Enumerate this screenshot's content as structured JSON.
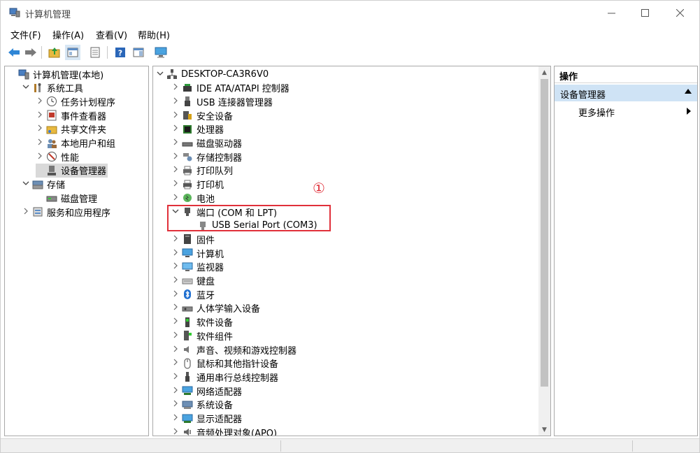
{
  "window": {
    "title": "计算机管理"
  },
  "menu": [
    "文件(F)",
    "操作(A)",
    "查看(V)",
    "帮助(H)"
  ],
  "left_tree": [
    {
      "label": "计算机管理(本地)",
      "level": 0,
      "arrow": "",
      "icon": "computer-management-icon"
    },
    {
      "label": "系统工具",
      "level": 1,
      "arrow": "v",
      "icon": "system-tools-icon"
    },
    {
      "label": "任务计划程序",
      "level": 2,
      "arrow": ">",
      "icon": "clock-icon"
    },
    {
      "label": "事件查看器",
      "level": 2,
      "arrow": ">",
      "icon": "event-viewer-icon"
    },
    {
      "label": "共享文件夹",
      "level": 2,
      "arrow": ">",
      "icon": "shared-folder-icon"
    },
    {
      "label": "本地用户和组",
      "level": 2,
      "arrow": ">",
      "icon": "users-icon"
    },
    {
      "label": "性能",
      "level": 2,
      "arrow": ">",
      "icon": "performance-icon"
    },
    {
      "label": "设备管理器",
      "level": 2,
      "arrow": "",
      "icon": "device-manager-icon",
      "selected": true
    },
    {
      "label": "存储",
      "level": 1,
      "arrow": "v",
      "icon": "storage-icon"
    },
    {
      "label": "磁盘管理",
      "level": 2,
      "arrow": "",
      "icon": "disk-management-icon"
    },
    {
      "label": "服务和应用程序",
      "level": 1,
      "arrow": ">",
      "icon": "services-icon"
    }
  ],
  "device_tree": [
    {
      "label": "DESKTOP-CA3R6V0",
      "level": 0,
      "arrow": "v",
      "icon": "computer-node-icon"
    },
    {
      "label": "IDE ATA/ATAPI 控制器",
      "level": 1,
      "arrow": ">",
      "icon": "ide-controller-icon"
    },
    {
      "label": "USB 连接器管理器",
      "level": 1,
      "arrow": ">",
      "icon": "usb-connector-icon"
    },
    {
      "label": "安全设备",
      "level": 1,
      "arrow": ">",
      "icon": "security-device-icon"
    },
    {
      "label": "处理器",
      "level": 1,
      "arrow": ">",
      "icon": "processor-icon"
    },
    {
      "label": "磁盘驱动器",
      "level": 1,
      "arrow": ">",
      "icon": "disk-drive-icon"
    },
    {
      "label": "存储控制器",
      "level": 1,
      "arrow": ">",
      "icon": "storage-controller-icon"
    },
    {
      "label": "打印队列",
      "level": 1,
      "arrow": ">",
      "icon": "print-queue-icon"
    },
    {
      "label": "打印机",
      "level": 1,
      "arrow": ">",
      "icon": "printer-icon"
    },
    {
      "label": "电池",
      "level": 1,
      "arrow": ">",
      "icon": "battery-icon"
    },
    {
      "label": "端口 (COM 和 LPT)",
      "level": 1,
      "arrow": "v",
      "icon": "port-icon"
    },
    {
      "label": "USB Serial Port (COM3)",
      "level": 2,
      "arrow": "",
      "icon": "serial-port-icon"
    },
    {
      "label": "固件",
      "level": 1,
      "arrow": ">",
      "icon": "firmware-icon"
    },
    {
      "label": "计算机",
      "level": 1,
      "arrow": ">",
      "icon": "monitor-computer-icon"
    },
    {
      "label": "监视器",
      "level": 1,
      "arrow": ">",
      "icon": "monitor-icon"
    },
    {
      "label": "键盘",
      "level": 1,
      "arrow": ">",
      "icon": "keyboard-icon"
    },
    {
      "label": "蓝牙",
      "level": 1,
      "arrow": ">",
      "icon": "bluetooth-icon"
    },
    {
      "label": "人体学输入设备",
      "level": 1,
      "arrow": ">",
      "icon": "hid-icon"
    },
    {
      "label": "软件设备",
      "level": 1,
      "arrow": ">",
      "icon": "software-device-icon"
    },
    {
      "label": "软件组件",
      "level": 1,
      "arrow": ">",
      "icon": "software-component-icon"
    },
    {
      "label": "声音、视频和游戏控制器",
      "level": 1,
      "arrow": ">",
      "icon": "speaker-icon"
    },
    {
      "label": "鼠标和其他指针设备",
      "level": 1,
      "arrow": ">",
      "icon": "mouse-icon"
    },
    {
      "label": "通用串行总线控制器",
      "level": 1,
      "arrow": ">",
      "icon": "usb-controller-icon"
    },
    {
      "label": "网络适配器",
      "level": 1,
      "arrow": ">",
      "icon": "network-adapter-icon"
    },
    {
      "label": "系统设备",
      "level": 1,
      "arrow": ">",
      "icon": "system-device-icon"
    },
    {
      "label": "显示适配器",
      "level": 1,
      "arrow": ">",
      "icon": "display-adapter-icon"
    },
    {
      "label": "音频处理对象(APO)",
      "level": 1,
      "arrow": ">",
      "icon": "audio-object-icon"
    }
  ],
  "actions": {
    "header": "操作",
    "section": "设备管理器",
    "more": "更多操作"
  },
  "annotation": {
    "marker": "①",
    "color": "#e0303a"
  },
  "colors": {
    "selection": "#d9d9d9",
    "action_section": "#cfe3f5"
  }
}
